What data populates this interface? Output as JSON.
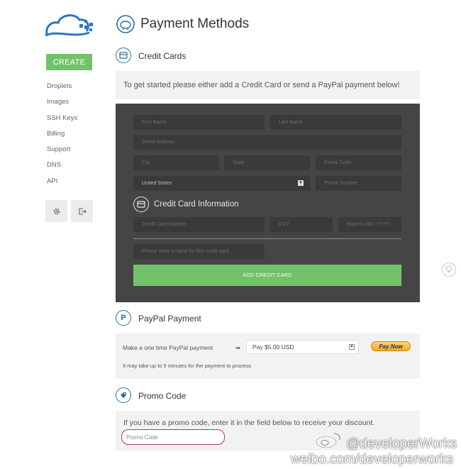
{
  "sidebar": {
    "create_label": "CREATE",
    "items": [
      {
        "label": "Droplets"
      },
      {
        "label": "Images"
      },
      {
        "label": "SSH Keys"
      },
      {
        "label": "Billing"
      },
      {
        "label": "Support"
      },
      {
        "label": "DNS"
      },
      {
        "label": "API"
      }
    ],
    "icons": [
      "gear-icon",
      "logout-icon"
    ]
  },
  "page": {
    "title": "Payment Methods"
  },
  "credit_cards": {
    "section_title": "Credit Cards",
    "intro": "To get started please either add a Credit Card or send a PayPal payment below!",
    "first_name_placeholder": "First Name",
    "last_name_placeholder": "Last Name",
    "street_placeholder": "Street Address",
    "city_placeholder": "City",
    "state_placeholder": "State",
    "postal_placeholder": "Postal Code",
    "country_value": "United States",
    "phone_placeholder": "Phone Number",
    "cc_info_title": "Credit Card Information",
    "card_number_placeholder": "Credit Card Number",
    "cvv_placeholder": "CVV",
    "expires_placeholder": "Expires MM / YYYY",
    "card_name_placeholder": "Please enter a name for this credit card",
    "add_button": "ADD CREDIT CARD"
  },
  "paypal": {
    "section_title": "PayPal Payment",
    "label": "Make a one time PayPal payment",
    "arrow": "➡",
    "amount_value": "Pay $5.00 USD",
    "pay_now": "Pay Now",
    "note": "It may take up to 5 minutes for the payment to process"
  },
  "promo": {
    "section_title": "Promo Code",
    "text": "If you have a promo code, enter it in the field below to receive your discount.",
    "input_placeholder": "Promo Code"
  },
  "watermark": {
    "handle": "@developerWorks",
    "url": "weibo.com/developerworks"
  },
  "colors": {
    "accent_green": "#72c26b",
    "brand_blue": "#2b6ea0",
    "dark_panel": "#454545",
    "promo_highlight": "#b63c4a"
  }
}
